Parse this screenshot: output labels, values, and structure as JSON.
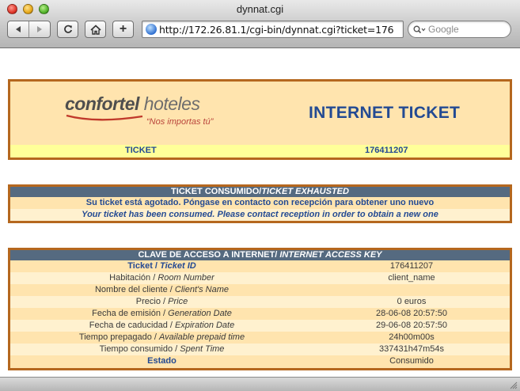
{
  "browser": {
    "window_title": "dynnat.cgi",
    "address_url": "http://172.26.81.1/cgi-bin/dynnat.cgi?ticket=176",
    "search_placeholder": "Google",
    "add_label": "+"
  },
  "header": {
    "logo_word_main": "confortel",
    "logo_word_second": "hoteles",
    "logo_tagline": "“Nos importas tú”",
    "title": "INTERNET TICKET",
    "ticket_label": "TICKET",
    "ticket_value": "176411207"
  },
  "exhausted": {
    "band_es": "TICKET CONSUMIDO/",
    "band_en": "TICKET EXHAUSTED",
    "message_es": "Su ticket está agotado. Póngase en contacto con recepción para obtener uno nuevo",
    "message_en": "Your ticket has been consumed. Please contact reception in order to obtain a new one"
  },
  "access_key": {
    "band_es": "CLAVE DE ACCESO A INTERNET/ ",
    "band_en": "INTERNET ACCESS KEY",
    "rows": [
      {
        "label_es": "Ticket / ",
        "label_en": "Ticket ID",
        "value": "176411207"
      },
      {
        "label_es": "Habitación / ",
        "label_en": "Room Number",
        "value": "client_name"
      },
      {
        "label_es": "Nombre del cliente / ",
        "label_en": "Client's Name",
        "value": ""
      },
      {
        "label_es": "Precio / ",
        "label_en": "Price",
        "value": "0 euros"
      },
      {
        "label_es": "Fecha de emisión / ",
        "label_en": "Generation Date",
        "value": "28-06-08 20:57:50"
      },
      {
        "label_es": "Fecha de caducidad / ",
        "label_en": "Expiration Date",
        "value": "29-06-08 20:57:50"
      },
      {
        "label_es": "Tiempo prepagado / ",
        "label_en": "Available prepaid time",
        "value": "24h00m00s"
      },
      {
        "label_es": "Tiempo consumido / ",
        "label_en": "Spent Time",
        "value": "337431h47m54s"
      },
      {
        "label_es": "Estado",
        "label_en": "",
        "value": "Consumido"
      }
    ]
  },
  "colors": {
    "accent_blue": "#234a93",
    "border_brown": "#b5671e",
    "panel_bg": "#ffe4ae",
    "band_bg": "#556a80",
    "strip_yellow": "#ffff99"
  }
}
